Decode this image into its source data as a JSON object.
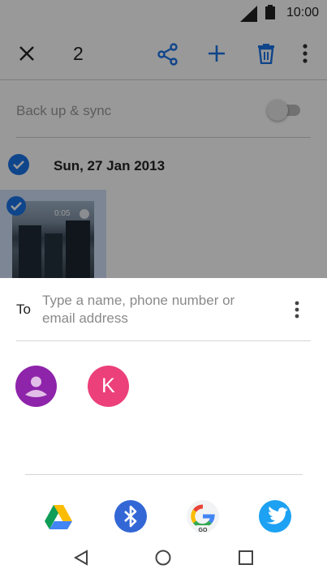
{
  "status_bar": {
    "time": "10:00"
  },
  "toolbar": {
    "selected_count": "2"
  },
  "backup": {
    "label": "Back up & sync",
    "enabled": false
  },
  "date_header": {
    "label": "Sun, 27 Jan 2013",
    "selected": true
  },
  "photo": {
    "duration": "0:05",
    "selected": true
  },
  "share_sheet": {
    "to_label": "To",
    "to_placeholder": "Type a name, phone number or email address",
    "to_value": "",
    "contacts": [
      {
        "initial": "",
        "color": "#8e24aa",
        "type": "placeholder-avatar"
      },
      {
        "initial": "K",
        "color": "#ec407a",
        "type": "initial-avatar"
      }
    ],
    "apps": [
      "drive-icon",
      "bluetooth-icon",
      "google-go-icon",
      "twitter-icon"
    ],
    "google_go_badge": "GO"
  },
  "colors": {
    "accent": "#1a73e8",
    "scrim": "rgba(0,0,0,0.40)"
  }
}
